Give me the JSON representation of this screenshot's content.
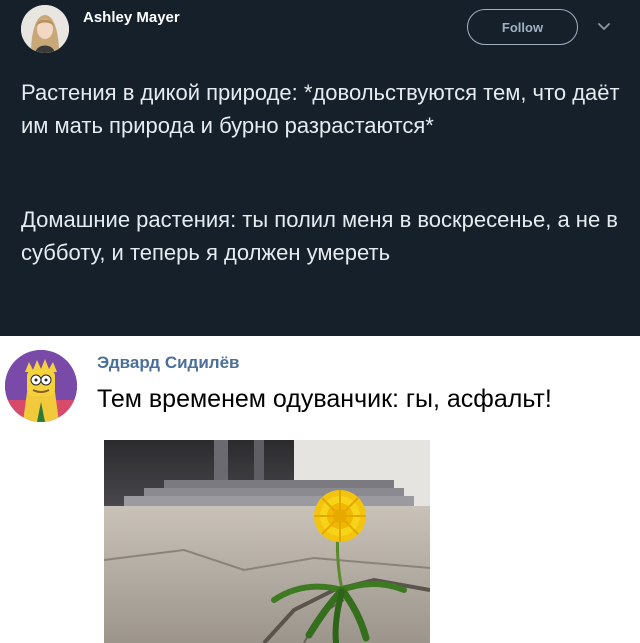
{
  "tweet": {
    "author_name": "Ashley Mayer",
    "follow_label": "Follow",
    "paragraph1": "Растения в дикой природе: *довольствуются тем, что даёт им мать природа и бурно разрастаются*",
    "paragraph2": "Домашние растения: ты полил меня в воскресенье, а не в субботу, и теперь я должен умереть"
  },
  "comment": {
    "author_name": "Эдвард Сидилёв",
    "text": "Тем временем одуванчик: гы, асфальт!"
  },
  "colors": {
    "tweet_bg": "#15202b",
    "tweet_text": "#e6ebef",
    "follow_border": "#9fb0c3",
    "comment_name": "#4a6f99"
  },
  "icons": {
    "chevron": "chevron-down-icon"
  }
}
